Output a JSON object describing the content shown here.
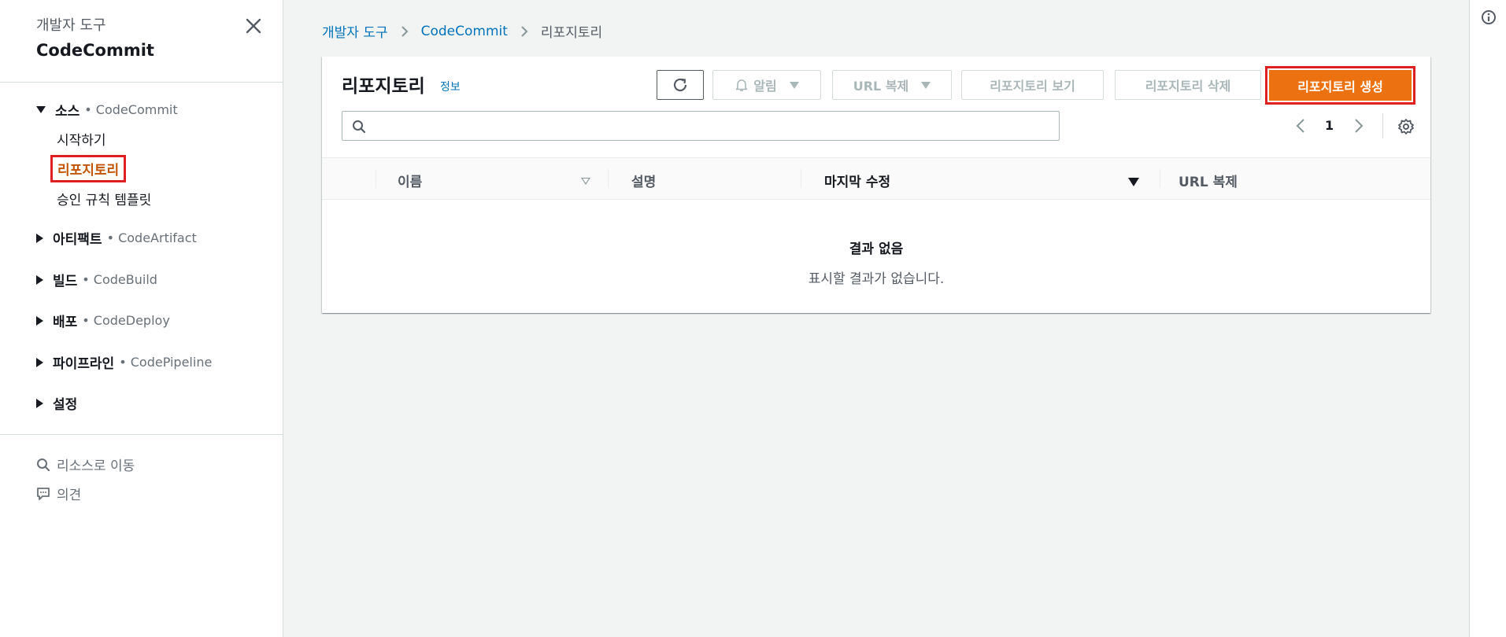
{
  "sidebar": {
    "section": "개발자 도구",
    "title": "CodeCommit",
    "groups": [
      {
        "label": "소스",
        "sub": "• CodeCommit",
        "expanded": true,
        "items": [
          {
            "label": "시작하기"
          },
          {
            "label": "리포지토리",
            "active": true
          },
          {
            "label": "승인 규칙 템플릿"
          }
        ]
      },
      {
        "label": "아티팩트",
        "sub": "• CodeArtifact",
        "expanded": false
      },
      {
        "label": "빌드",
        "sub": "• CodeBuild",
        "expanded": false
      },
      {
        "label": "배포",
        "sub": "• CodeDeploy",
        "expanded": false
      },
      {
        "label": "파이프라인",
        "sub": "• CodePipeline",
        "expanded": false
      },
      {
        "label": "설정",
        "sub": "",
        "expanded": false
      }
    ],
    "tools": [
      {
        "label": "리소스로 이동",
        "icon": "search-icon"
      },
      {
        "label": "의견",
        "icon": "feedback-icon"
      }
    ]
  },
  "breadcrumb": {
    "items": [
      "개발자 도구",
      "CodeCommit",
      "리포지토리"
    ]
  },
  "panel": {
    "title": "리포지토리",
    "info": "정보",
    "buttons": {
      "notify": "알림",
      "clone_url": "URL 복제",
      "view": "리포지토리 보기",
      "delete": "리포지토리 삭제",
      "create": "리포지토리 생성"
    },
    "search": {
      "value": "",
      "placeholder": ""
    },
    "pagination": {
      "current_page": "1"
    },
    "columns": [
      "이름",
      "설명",
      "마지막 수정",
      "URL 복제"
    ],
    "rows": [],
    "empty": {
      "title": "결과 없음",
      "description": "표시할 결과가 없습니다."
    }
  },
  "colors": {
    "primary": "#ec7211",
    "link": "#0073bb",
    "active_nav": "#c45500",
    "highlight_border": "#e02020"
  }
}
